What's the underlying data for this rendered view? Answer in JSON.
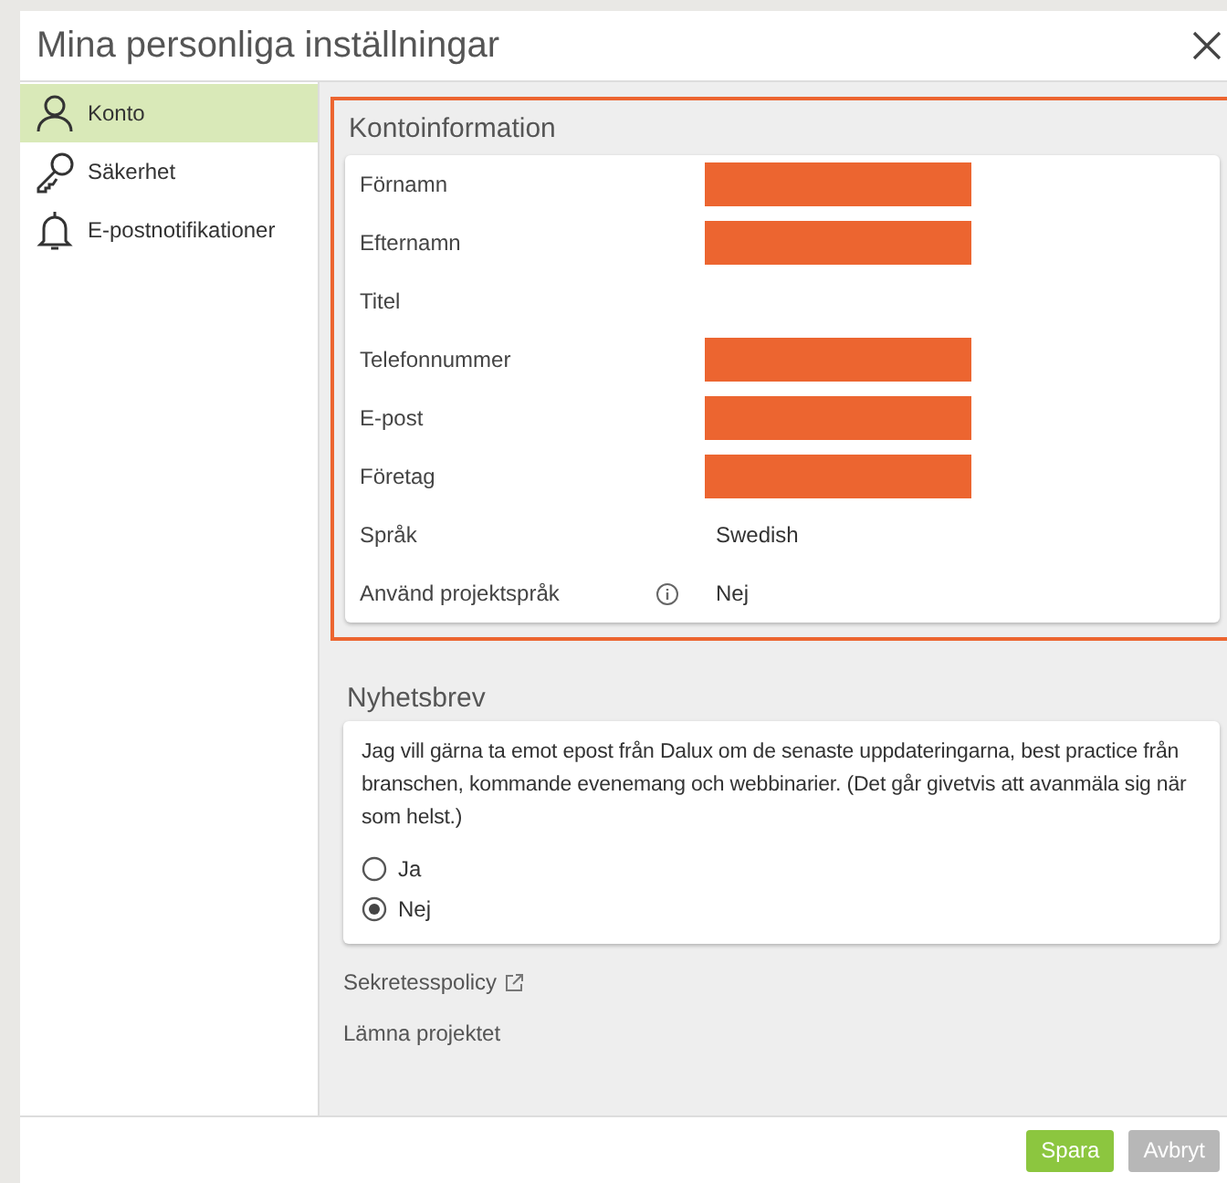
{
  "window": {
    "title": "Mina personliga inställningar"
  },
  "sidebar": {
    "items": [
      {
        "label": "Konto",
        "selected": true
      },
      {
        "label": "Säkerhet",
        "selected": false
      },
      {
        "label": "E-postnotifikationer",
        "selected": false
      }
    ]
  },
  "account": {
    "title": "Kontoinformation",
    "highlighted": true,
    "rows": [
      {
        "label": "Förnamn",
        "kind": "redacted",
        "info": false
      },
      {
        "label": "Efternamn",
        "kind": "redacted",
        "info": false
      },
      {
        "label": "Titel",
        "kind": "empty",
        "info": false
      },
      {
        "label": "Telefonnummer",
        "kind": "redacted",
        "info": false
      },
      {
        "label": "E-post",
        "kind": "redacted",
        "info": false
      },
      {
        "label": "Företag",
        "kind": "redacted",
        "info": false
      },
      {
        "label": "Språk",
        "kind": "text",
        "value": "Swedish",
        "info": false
      },
      {
        "label": "Använd projektspråk",
        "kind": "text",
        "value": "Nej",
        "info": true
      }
    ]
  },
  "newsletter": {
    "title": "Nyhetsbrev",
    "text": "Jag vill gärna ta emot epost från Dalux om de senaste uppdateringarna, best practice från branschen, kommande evenemang och webbinarier. (Det går givetvis att avanmäla sig när som helst.)",
    "options": [
      {
        "label": "Ja",
        "selected": false
      },
      {
        "label": "Nej",
        "selected": true
      }
    ]
  },
  "links": [
    {
      "label": "Sekretesspolicy",
      "external": true
    },
    {
      "label": "Lämna projektet",
      "external": false
    }
  ],
  "buttons": [
    {
      "label": "Spara",
      "kind": "primary"
    },
    {
      "label": "Avbryt",
      "kind": "secondary"
    }
  ]
}
